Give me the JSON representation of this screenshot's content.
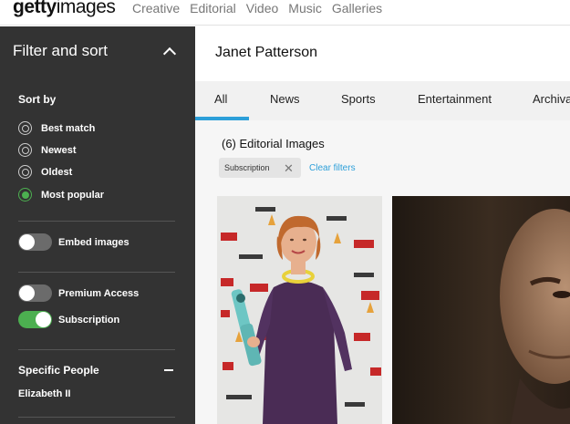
{
  "logo": {
    "bold": "getty",
    "light": "images"
  },
  "nav": [
    "Creative",
    "Editorial",
    "Video",
    "Music",
    "Galleries"
  ],
  "sidebar": {
    "title": "Filter and sort",
    "sort_label": "Sort by",
    "sort_options": [
      "Best match",
      "Newest",
      "Oldest",
      "Most popular"
    ],
    "selected_sort": "Most popular",
    "embed_label": "Embed images",
    "premium_label": "Premium Access",
    "subscription_label": "Subscription",
    "people_label": "Specific People",
    "people_value": "Elizabeth II"
  },
  "main": {
    "title": "Janet Patterson",
    "tabs": [
      "All",
      "News",
      "Sports",
      "Entertainment",
      "Archival"
    ],
    "result_count": "(6) Editorial Images",
    "filter_chip": "Subscription",
    "clear_filters": "Clear filters"
  },
  "colors": {
    "accent": "#2c9fd9",
    "toggle_on": "#4caf50",
    "sidebar_bg": "#333333"
  }
}
